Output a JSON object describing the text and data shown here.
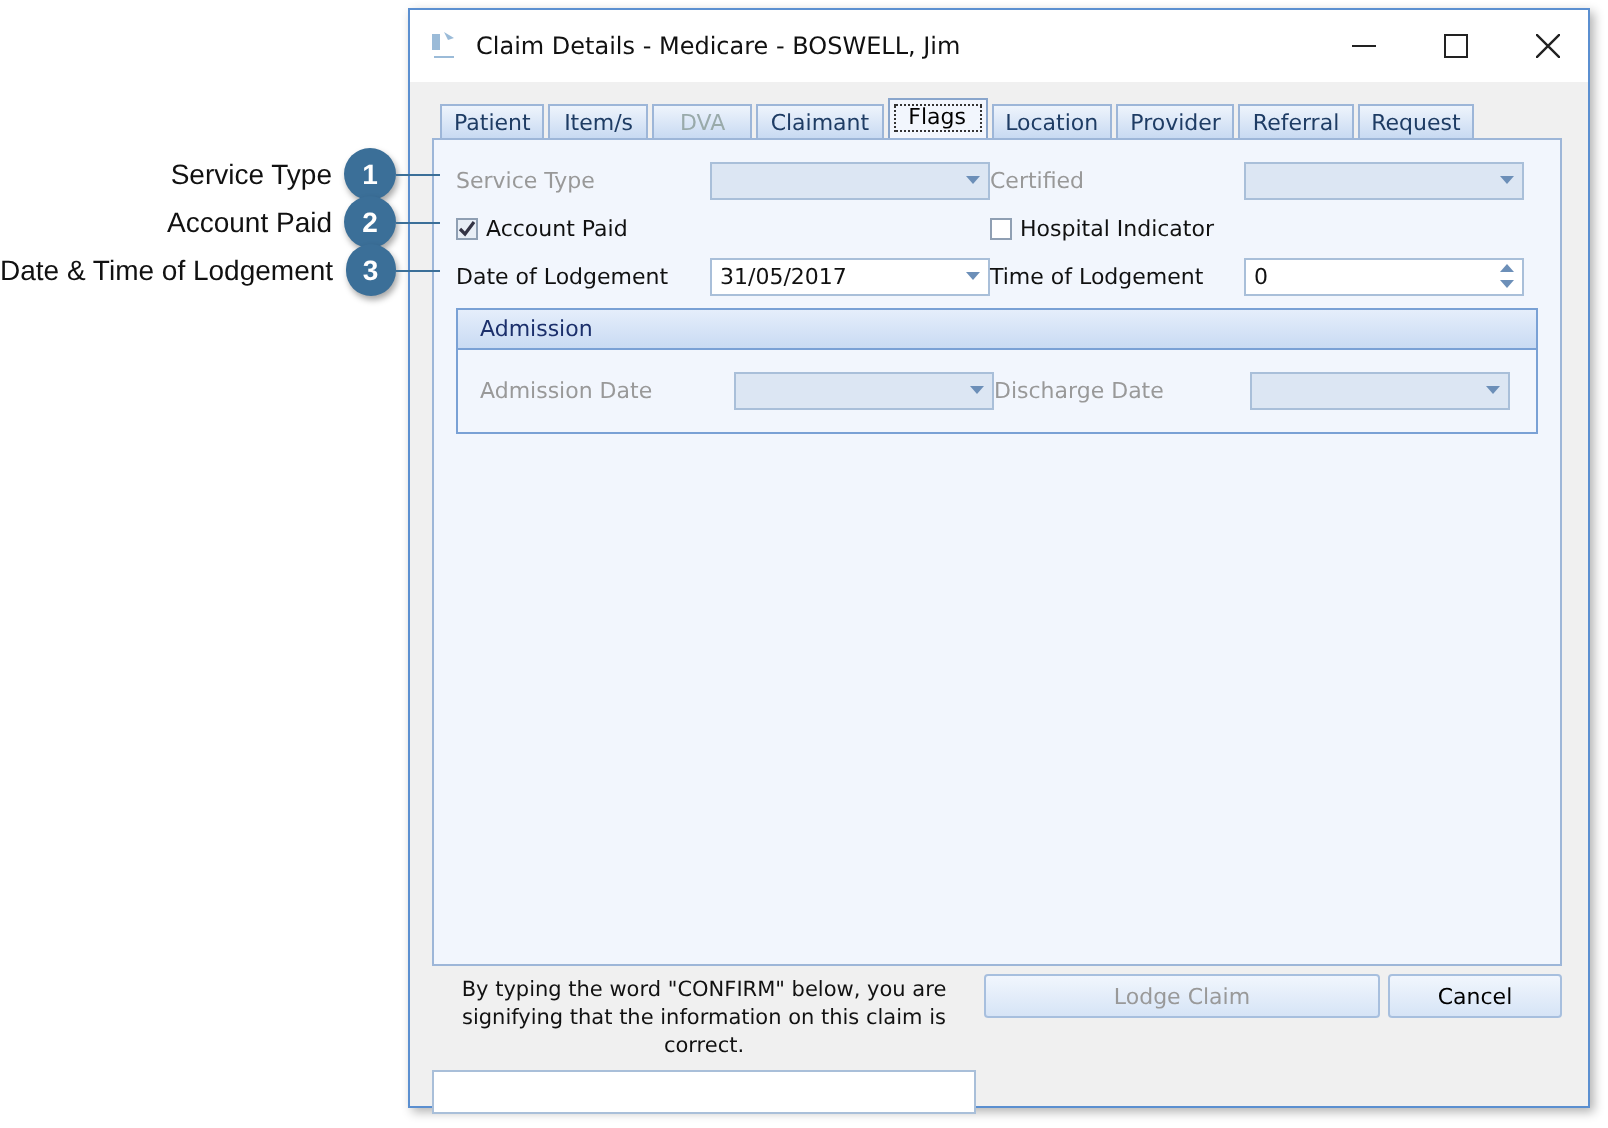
{
  "callouts": [
    {
      "number": "1",
      "label": "Service Type"
    },
    {
      "number": "2",
      "label": "Account Paid"
    },
    {
      "number": "3",
      "label": "Date & Time of Lodgement"
    }
  ],
  "window": {
    "title": "Claim Details - Medicare - BOSWELL, Jim"
  },
  "tabs": [
    {
      "label": "Patient",
      "selected": false,
      "disabled": false
    },
    {
      "label": "Item/s",
      "selected": false,
      "disabled": false
    },
    {
      "label": "DVA",
      "selected": false,
      "disabled": true
    },
    {
      "label": "Claimant",
      "selected": false,
      "disabled": false
    },
    {
      "label": "Flags",
      "selected": true,
      "disabled": false
    },
    {
      "label": "Location",
      "selected": false,
      "disabled": false
    },
    {
      "label": "Provider",
      "selected": false,
      "disabled": false
    },
    {
      "label": "Referral",
      "selected": false,
      "disabled": false
    },
    {
      "label": "Request",
      "selected": false,
      "disabled": false
    }
  ],
  "form": [
    [
      {
        "kind": "combo",
        "label": "Service Type",
        "disabled": true
      },
      {
        "kind": "combo",
        "label": "Certified",
        "disabled": true
      }
    ],
    [
      {
        "kind": "checkbox",
        "label": "Account Paid",
        "checked": true
      },
      {
        "kind": "checkbox",
        "label": "Hospital Indicator",
        "checked": false
      }
    ],
    [
      {
        "kind": "combo",
        "label": "Date of Lodgement",
        "value": "31/05/2017",
        "disabled": false
      },
      {
        "kind": "spin",
        "label": "Time of Lodgement",
        "value": "0"
      }
    ]
  ],
  "admission": {
    "title": "Admission",
    "fields": [
      {
        "kind": "combo",
        "label": "Admission Date",
        "disabled": true
      },
      {
        "kind": "combo",
        "label": "Discharge Date",
        "disabled": true
      }
    ]
  },
  "confirm": {
    "text": "By typing the word \"CONFIRM\" below, you are signifying that the information on this claim is correct."
  },
  "buttons": [
    {
      "label": "Lodge Claim",
      "disabled": true
    },
    {
      "label": "Cancel",
      "disabled": false
    }
  ]
}
